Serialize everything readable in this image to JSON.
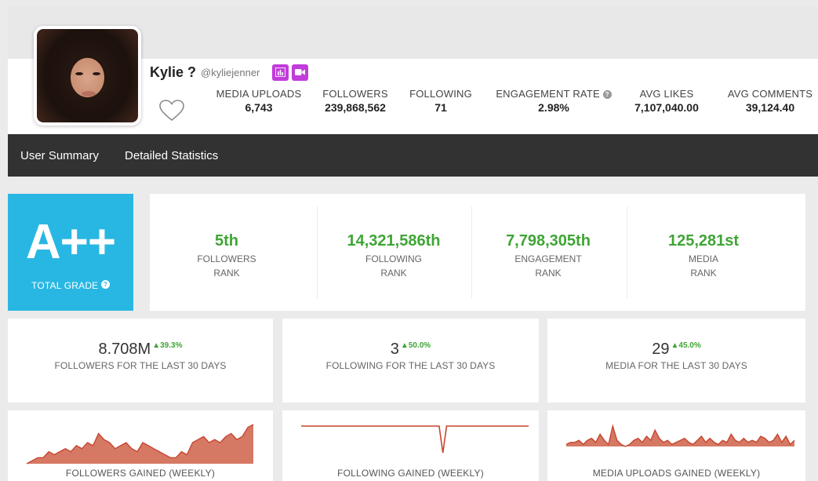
{
  "profile": {
    "display_name": "Kylie ?",
    "username": "@kyliejenner",
    "stats": [
      {
        "label": "MEDIA UPLOADS",
        "value": "6,743"
      },
      {
        "label": "FOLLOWERS",
        "value": "239,868,562"
      },
      {
        "label": "FOLLOWING",
        "value": "71"
      },
      {
        "label": "ENGAGEMENT RATE",
        "value": "2.98%"
      },
      {
        "label": "AVG LIKES",
        "value": "7,107,040.00"
      },
      {
        "label": "AVG COMMENTS",
        "value": "39,124.40"
      }
    ],
    "icons": [
      "chart-button-icon",
      "video-button-icon",
      "heart-icon",
      "help-icon"
    ]
  },
  "nav": {
    "items": [
      "User Summary",
      "Detailed Statistics"
    ]
  },
  "grade": {
    "value": "A++",
    "label": "TOTAL GRADE"
  },
  "ranks": [
    {
      "value": "5th",
      "line1": "FOLLOWERS",
      "line2": "RANK"
    },
    {
      "value": "14,321,586th",
      "line1": "FOLLOWING",
      "line2": "RANK"
    },
    {
      "value": "7,798,305th",
      "line1": "ENGAGEMENT",
      "line2": "RANK"
    },
    {
      "value": "125,281st",
      "line1": "MEDIA",
      "line2": "RANK"
    }
  ],
  "last30": [
    {
      "value": "8.708M",
      "change": "▲39.3%",
      "caption": "FOLLOWERS FOR THE LAST 30 DAYS"
    },
    {
      "value": "3",
      "change": "▲50.0%",
      "caption": "FOLLOWING FOR THE LAST 30 DAYS"
    },
    {
      "value": "29",
      "change": "▲45.0%",
      "caption": "MEDIA FOR THE LAST 30 DAYS"
    }
  ],
  "charts": [
    {
      "title": "FOLLOWERS GAINED (WEEKLY)",
      "type": "area",
      "values": [
        2,
        3,
        4,
        4,
        6,
        5,
        6,
        7,
        6,
        8,
        7,
        9,
        8,
        12,
        10,
        9,
        7,
        8,
        9,
        7,
        6,
        9,
        8,
        7,
        6,
        5,
        4,
        4,
        6,
        5,
        9,
        10,
        11,
        9,
        10,
        9,
        11,
        12,
        10,
        11,
        14,
        15
      ]
    },
    {
      "title": "FOLLOWING GAINED (WEEKLY)",
      "type": "line",
      "values": [
        1,
        1,
        1,
        1,
        1,
        1,
        1,
        1,
        1,
        1,
        1,
        1,
        1,
        1,
        1,
        1,
        1,
        1,
        1,
        1,
        1,
        1,
        1,
        1,
        1,
        1,
        1,
        1,
        1,
        1,
        1,
        1,
        1,
        1,
        1,
        1,
        1,
        1,
        -20,
        1,
        1,
        1,
        1,
        1,
        1,
        1,
        1,
        1,
        1,
        1,
        1,
        1,
        1,
        1,
        1,
        1,
        1,
        1,
        1,
        1,
        1,
        1
      ]
    },
    {
      "title": "MEDIA UPLOADS GAINED (WEEKLY)",
      "type": "area",
      "values": [
        4,
        5,
        5,
        6,
        4,
        6,
        7,
        5,
        9,
        6,
        4,
        13,
        6,
        4,
        3,
        4,
        6,
        7,
        5,
        8,
        6,
        11,
        7,
        5,
        6,
        4,
        5,
        6,
        7,
        5,
        4,
        6,
        8,
        5,
        7,
        5,
        4,
        6,
        5,
        9,
        6,
        5,
        7,
        5,
        6,
        5,
        8,
        7,
        5,
        6,
        9,
        5,
        8,
        4,
        6
      ]
    }
  ],
  "colors": {
    "brand_purple": "#c13cdb",
    "grade_blue": "#28b7e3",
    "positive_green": "#3fa535",
    "chart_fill": "#d57964",
    "chart_stroke": "#c8452f",
    "nav_bg": "#323232"
  }
}
